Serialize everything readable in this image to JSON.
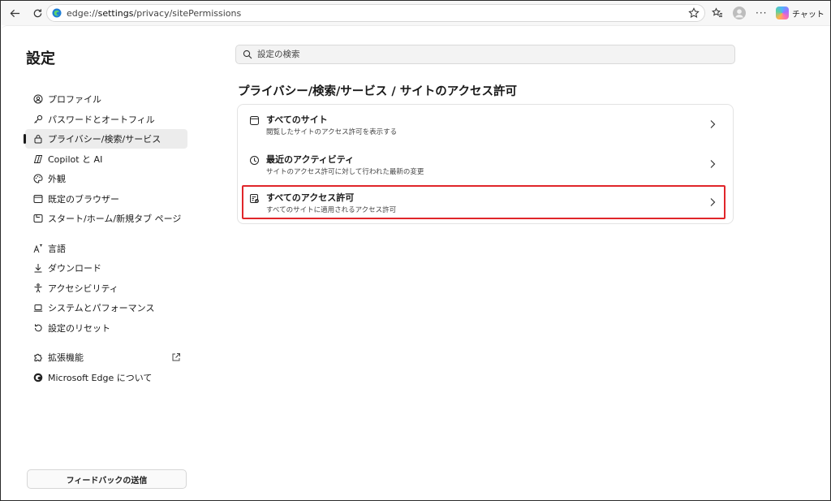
{
  "browser": {
    "url_prefix": "edge://",
    "url_host": "settings",
    "url_path": "/privacy/sitePermissions",
    "chat_label": "チャット"
  },
  "sidebar": {
    "title": "設定",
    "items": [
      {
        "label": "プロファイル",
        "icon": "profile-icon"
      },
      {
        "label": "パスワードとオートフィル",
        "icon": "key-icon"
      },
      {
        "label": "プライバシー/検索/サービス",
        "icon": "lock-icon",
        "active": true
      },
      {
        "label": "Copilot と AI",
        "icon": "copilot-icon"
      },
      {
        "label": "外観",
        "icon": "palette-icon"
      },
      {
        "label": "既定のブラウザー",
        "icon": "browser-icon"
      },
      {
        "label": "スタート/ホーム/新規タブ ページ",
        "icon": "home-icon"
      },
      {
        "label": "言語",
        "icon": "language-icon"
      },
      {
        "label": "ダウンロード",
        "icon": "download-icon"
      },
      {
        "label": "アクセシビリティ",
        "icon": "accessibility-icon"
      },
      {
        "label": "システムとパフォーマンス",
        "icon": "laptop-icon"
      },
      {
        "label": "設定のリセット",
        "icon": "reset-icon"
      },
      {
        "label": "拡張機能",
        "icon": "puzzle-icon"
      },
      {
        "label": "Microsoft Edge について",
        "icon": "edge-logo-icon"
      }
    ],
    "feedback_label": "フィードバックの送信"
  },
  "main": {
    "search_placeholder": "設定の検索",
    "title": "プライバシー/検索/サービス / サイトのアクセス許可",
    "rows": [
      {
        "title": "すべてのサイト",
        "subtitle": "閲覧したサイトのアクセス許可を表示する",
        "icon": "site-window-icon"
      },
      {
        "title": "最近のアクティビティ",
        "subtitle": "サイトのアクセス許可に対して行われた最新の変更",
        "icon": "clock-icon"
      },
      {
        "title": "すべてのアクセス許可",
        "subtitle": "すべてのサイトに適用されるアクセス許可",
        "icon": "permissions-list-icon",
        "highlighted": true
      }
    ]
  },
  "colors": {
    "highlight": "#e0262a",
    "active_item_bg": "#ececec"
  }
}
